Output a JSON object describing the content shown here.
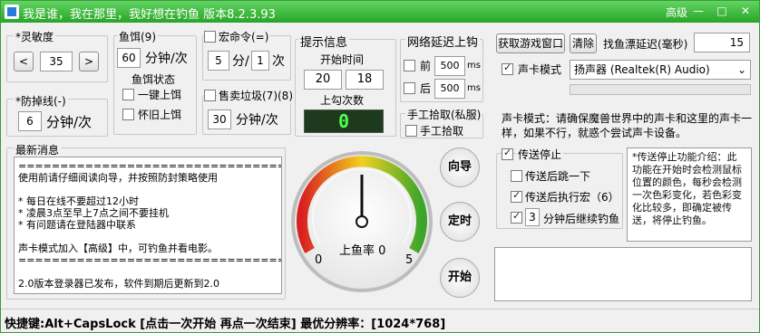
{
  "window": {
    "title": "我是谁，我在那里，我好想在钓鱼  版本8.2.3.93",
    "advanced": "高级",
    "min_glyph": "—",
    "max_glyph": "□",
    "close_glyph": "✕"
  },
  "sensitivity": {
    "legend": "*灵敏度",
    "minus": "<",
    "value": "35",
    "plus": ">"
  },
  "anti_drop": {
    "legend": "*防掉线(-)",
    "value": "6",
    "unit": "分钟/次"
  },
  "bait": {
    "legend": "鱼饵(9)",
    "value": "60",
    "unit": "分钟/次",
    "status_title": "鱼饵状态",
    "one_key": "一键上饵",
    "nostalgia": "怀旧上饵"
  },
  "macro": {
    "legend": "宏命令(=)",
    "min_value": "5",
    "min_unit": "分/",
    "times_value": "1",
    "times_unit": "次"
  },
  "sell_junk": {
    "legend": "售卖垃圾(7)(8)",
    "value": "30",
    "unit": "分钟/次"
  },
  "hint": {
    "legend": "提示信息",
    "start_time": "开始时间",
    "hour": "20",
    "minute": "18",
    "hook_count_label": "上勾次数",
    "hook_count": "0"
  },
  "latency": {
    "legend": "网络延迟上钩",
    "front": "前",
    "front_value": "500",
    "back": "后",
    "back_value": "500",
    "unit": "ms"
  },
  "manual": {
    "legend": "手工拾取(私服)",
    "label": "手工拾取"
  },
  "top_right": {
    "get_window": "获取游戏窗口",
    "clear": "清除",
    "float_delay": "找鱼漂延迟(毫秒)",
    "float_delay_value": "15",
    "sound_mode": "声卡模式",
    "device": "扬声器 (Realtek(R) Audio)",
    "note": "声卡模式：请确保魔兽世界中的声卡和这里的声卡一样，如果不行，就惑个尝试声卡设备。"
  },
  "news": {
    "legend": "最新消息",
    "lines": [
      "==================================",
      "使用前请仔细阅读向导，并按照防封策略使用",
      "",
      "* 每日在线不要超过12小时",
      "* 凌晨3点至早上7点之间不要挂机",
      "* 有问题请在登陆器中联系",
      "",
      "声卡模式加入【高级】中，可钓鱼并看电影。",
      "==================================",
      "",
      "2.0版本登录器已发布，软件到期后更新到2.0"
    ]
  },
  "gauge": {
    "label": "上鱼率",
    "value": "0",
    "min_label": "0",
    "max_label": "5",
    "fraction": 0.5
  },
  "buttons": {
    "guide": "向导",
    "timer": "定时",
    "start": "开始"
  },
  "transfer": {
    "legend": "传送停止",
    "jump": "传送后跳一下",
    "macro": "传送后执行宏（6）",
    "minutes": "3",
    "continue": "分钟后继续钓鱼"
  },
  "transfer_info": "*传送停止功能介绍：此功能在开始时会检测鼠标位置的颜色，每秒会检测一次色彩变化，若色彩变化比较多，即确定被传送，将停止钓鱼。",
  "status_bar": "快捷键:Alt+CapsLock  [点击一次开始 再点一次结束]  最优分辨率：[1024*768]"
}
